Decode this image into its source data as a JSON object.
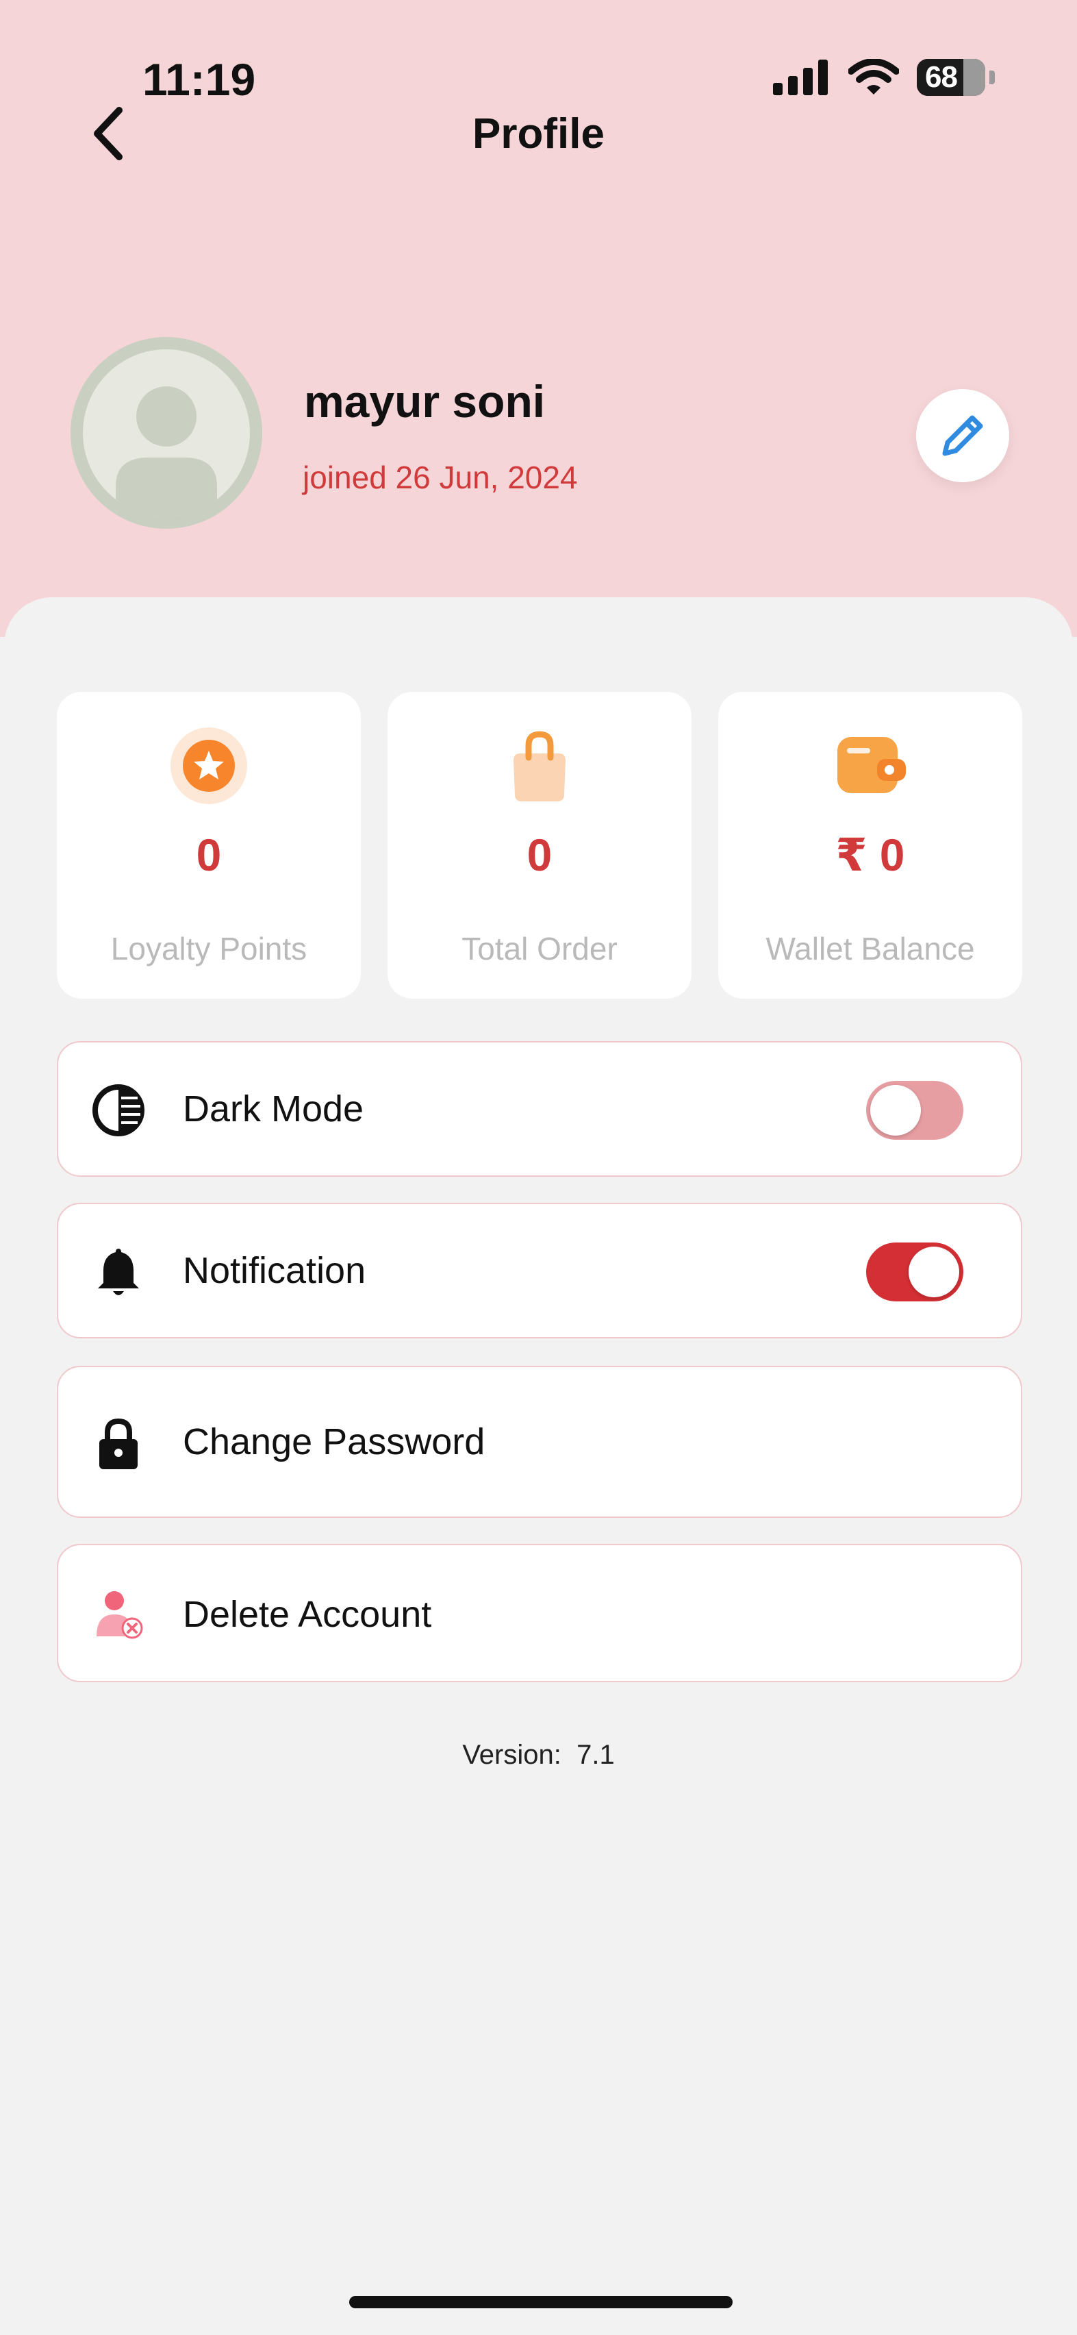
{
  "status_bar": {
    "time": "11:19",
    "battery": "68"
  },
  "header": {
    "title": "Profile"
  },
  "profile": {
    "name": "mayur soni",
    "joined": "joined 26 Jun, 2024"
  },
  "stats": [
    {
      "value": "0",
      "label": "Loyalty Points",
      "icon": "star-badge-icon"
    },
    {
      "value": "0",
      "label": "Total Order",
      "icon": "shopping-bag-icon"
    },
    {
      "value": "₹ 0",
      "label": "Wallet Balance",
      "icon": "wallet-icon"
    }
  ],
  "settings": [
    {
      "label": "Dark Mode",
      "icon": "contrast-icon",
      "toggle": false
    },
    {
      "label": "Notification",
      "icon": "bell-icon",
      "toggle": true
    },
    {
      "label": "Change Password",
      "icon": "lock-icon"
    },
    {
      "label": "Delete Account",
      "icon": "delete-user-icon"
    }
  ],
  "footer": {
    "version_label": "Version:",
    "version_value": "7.1"
  },
  "colors": {
    "header_bg": "#f6d5d8",
    "accent_red": "#d03a3a",
    "toggle_off": "#e79ea3",
    "orange": "#f39a3c"
  }
}
